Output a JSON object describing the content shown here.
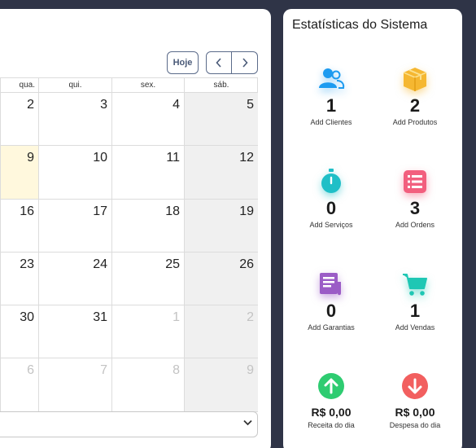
{
  "calendar": {
    "today_label": "Hoje",
    "day_headers": [
      "qua.",
      "qui.",
      "sex.",
      "sáb."
    ],
    "weeks": [
      [
        "2",
        "3",
        "4",
        "5"
      ],
      [
        "9",
        "10",
        "11",
        "12"
      ],
      [
        "16",
        "17",
        "18",
        "19"
      ],
      [
        "23",
        "24",
        "25",
        "26"
      ],
      [
        "30",
        "31",
        "1",
        "2"
      ],
      [
        "6",
        "7",
        "8",
        "9"
      ]
    ],
    "colors": {
      "today_bg": "#fff8dd",
      "weekend_bg": "#f0f0f0",
      "other_month_text": "#c3c3c3"
    }
  },
  "stats": {
    "title": "Estatísticas do Sistema",
    "items": [
      {
        "icon": "users-icon",
        "value": "1",
        "label": "Add Clientes",
        "color": "#1d9bf0"
      },
      {
        "icon": "box-icon",
        "value": "2",
        "label": "Add Produtos",
        "color": "#f5b731"
      },
      {
        "icon": "stopwatch-icon",
        "value": "0",
        "label": "Add Serviços",
        "color": "#1fbfc7"
      },
      {
        "icon": "list-icon",
        "value": "3",
        "label": "Add Ordens",
        "color": "#f25f7e"
      },
      {
        "icon": "document-icon",
        "value": "0",
        "label": "Add Garantias",
        "color": "#9b5cc6"
      },
      {
        "icon": "cart-icon",
        "value": "1",
        "label": "Add Vendas",
        "color": "#1fc7b4"
      },
      {
        "icon": "arrow-up-circle-icon",
        "value": "R$ 0,00",
        "label": "Receita do dia",
        "color": "#2ecc71"
      },
      {
        "icon": "arrow-down-circle-icon",
        "value": "R$ 0,00",
        "label": "Despesa do dia",
        "color": "#f25f5f"
      }
    ]
  }
}
